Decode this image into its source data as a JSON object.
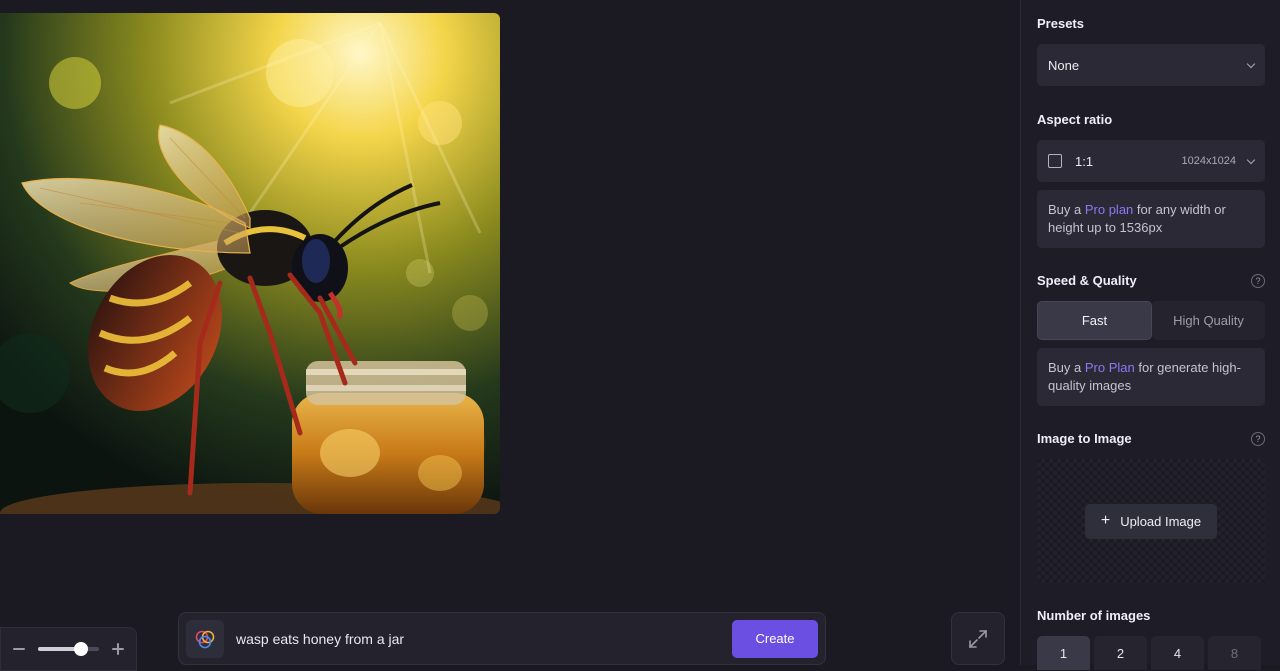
{
  "canvas": {
    "image_alt": "wasp eating honey from a jar",
    "zoom": {
      "value": 0.7
    }
  },
  "prompt": {
    "value": "wasp eats honey from a jar",
    "create_label": "Create"
  },
  "settings": {
    "presets": {
      "title": "Presets",
      "value": "None"
    },
    "aspect_ratio": {
      "title": "Aspect ratio",
      "value": "1:1",
      "size": "1024x1024",
      "info_prefix": "Buy a ",
      "info_link": "Pro plan",
      "info_suffix": " for any width or height up to 1536px"
    },
    "speed_quality": {
      "title": "Speed & Quality",
      "help": "?",
      "options": [
        "Fast",
        "High Quality"
      ],
      "selected": "Fast",
      "info_prefix": "Buy a ",
      "info_link": "Pro Plan",
      "info_suffix": " for generate high-quality images"
    },
    "image_to_image": {
      "title": "Image to Image",
      "help": "?",
      "upload_label": "Upload Image"
    },
    "number_of_images": {
      "title": "Number of images",
      "options": [
        "1",
        "2",
        "4",
        "8"
      ],
      "selected": "1",
      "disabled": [
        "8"
      ]
    }
  },
  "colors": {
    "accent": "#6b4fe3",
    "link": "#8b79f0",
    "background": "#1b1a23",
    "panel": "#1e1d27"
  }
}
